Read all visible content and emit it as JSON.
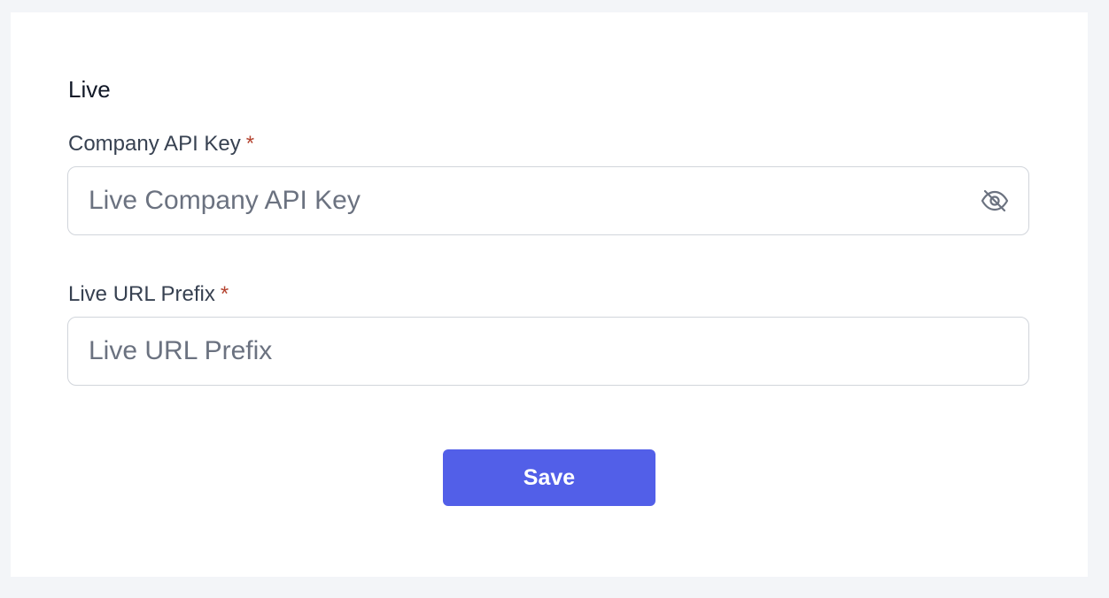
{
  "section": {
    "title": "Live"
  },
  "fields": {
    "api_key": {
      "label": "Company API Key",
      "required_mark": "*",
      "placeholder": "Live Company API Key",
      "value": "",
      "toggle_icon": "eye-off-icon"
    },
    "url_prefix": {
      "label": "Live URL Prefix",
      "required_mark": "*",
      "placeholder": "Live URL Prefix",
      "value": ""
    }
  },
  "actions": {
    "save_label": "Save"
  },
  "colors": {
    "page_background": "#f3f5f8",
    "card_background": "#ffffff",
    "accent": "#525fe8",
    "required": "#b4432f",
    "border": "#d1d5db"
  }
}
